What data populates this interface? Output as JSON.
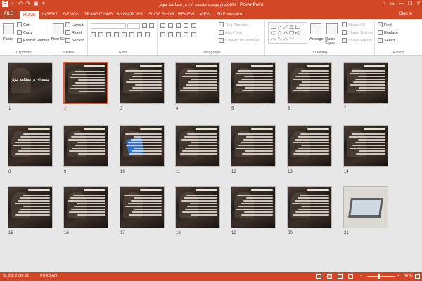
{
  "window": {
    "title": "پاورپوینت مقدمه ای بر مطالعه موثر.pptx - PowerPoint",
    "controls": [
      "?",
      "▭",
      "—",
      "❐",
      "✕"
    ]
  },
  "tabs": [
    "FILE",
    "HOME",
    "INSERT",
    "DESIGN",
    "TRANSITIONS",
    "ANIMATIONS",
    "SLIDE SHOW",
    "REVIEW",
    "VIEW",
    "FILEminimizer"
  ],
  "active_tab": "HOME",
  "signin": "Sign in",
  "ribbon": {
    "clipboard": {
      "paste": "Paste",
      "cut": "Cut",
      "copy": "Copy",
      "format_painter": "Format Painter",
      "label": "Clipboard"
    },
    "slides": {
      "new_slide": "New Slide",
      "layout": "Layout",
      "reset": "Reset",
      "section": "Section",
      "label": "Slides"
    },
    "font": {
      "label": "Font"
    },
    "paragraph": {
      "text_direction": "Text Direction",
      "align_text": "Align Text",
      "convert_smartart": "Convert to SmartArt",
      "label": "Paragraph"
    },
    "drawing": {
      "arrange": "Arrange",
      "quick_styles": "Quick Styles",
      "shape_fill": "Shape Fill",
      "shape_outline": "Shape Outline",
      "shape_effects": "Shape Effects",
      "label": "Drawing"
    },
    "editing": {
      "find": "Find",
      "replace": "Replace",
      "select": "Select",
      "label": "Editing"
    }
  },
  "slides": [
    {
      "n": "1",
      "kind": "title",
      "text": "مقدمه ای بر مطالعه موثر"
    },
    {
      "n": "2",
      "kind": "text",
      "selected": true
    },
    {
      "n": "3",
      "kind": "text"
    },
    {
      "n": "4",
      "kind": "text"
    },
    {
      "n": "5",
      "kind": "text"
    },
    {
      "n": "6",
      "kind": "text"
    },
    {
      "n": "7",
      "kind": "text"
    },
    {
      "n": "8",
      "kind": "text"
    },
    {
      "n": "9",
      "kind": "text"
    },
    {
      "n": "10",
      "kind": "blue"
    },
    {
      "n": "11",
      "kind": "text"
    },
    {
      "n": "12",
      "kind": "text"
    },
    {
      "n": "13",
      "kind": "text"
    },
    {
      "n": "14",
      "kind": "text"
    },
    {
      "n": "15",
      "kind": "text"
    },
    {
      "n": "16",
      "kind": "text"
    },
    {
      "n": "17",
      "kind": "text"
    },
    {
      "n": "18",
      "kind": "text"
    },
    {
      "n": "19",
      "kind": "text"
    },
    {
      "n": "20",
      "kind": "text"
    },
    {
      "n": "21",
      "kind": "laptop"
    }
  ],
  "status": {
    "slide_info": "SLIDE 2 OF 21",
    "language": "PERSIAN",
    "zoom": "60 %"
  },
  "colors": {
    "accent": "#d24726",
    "selection": "#e35b3b"
  }
}
